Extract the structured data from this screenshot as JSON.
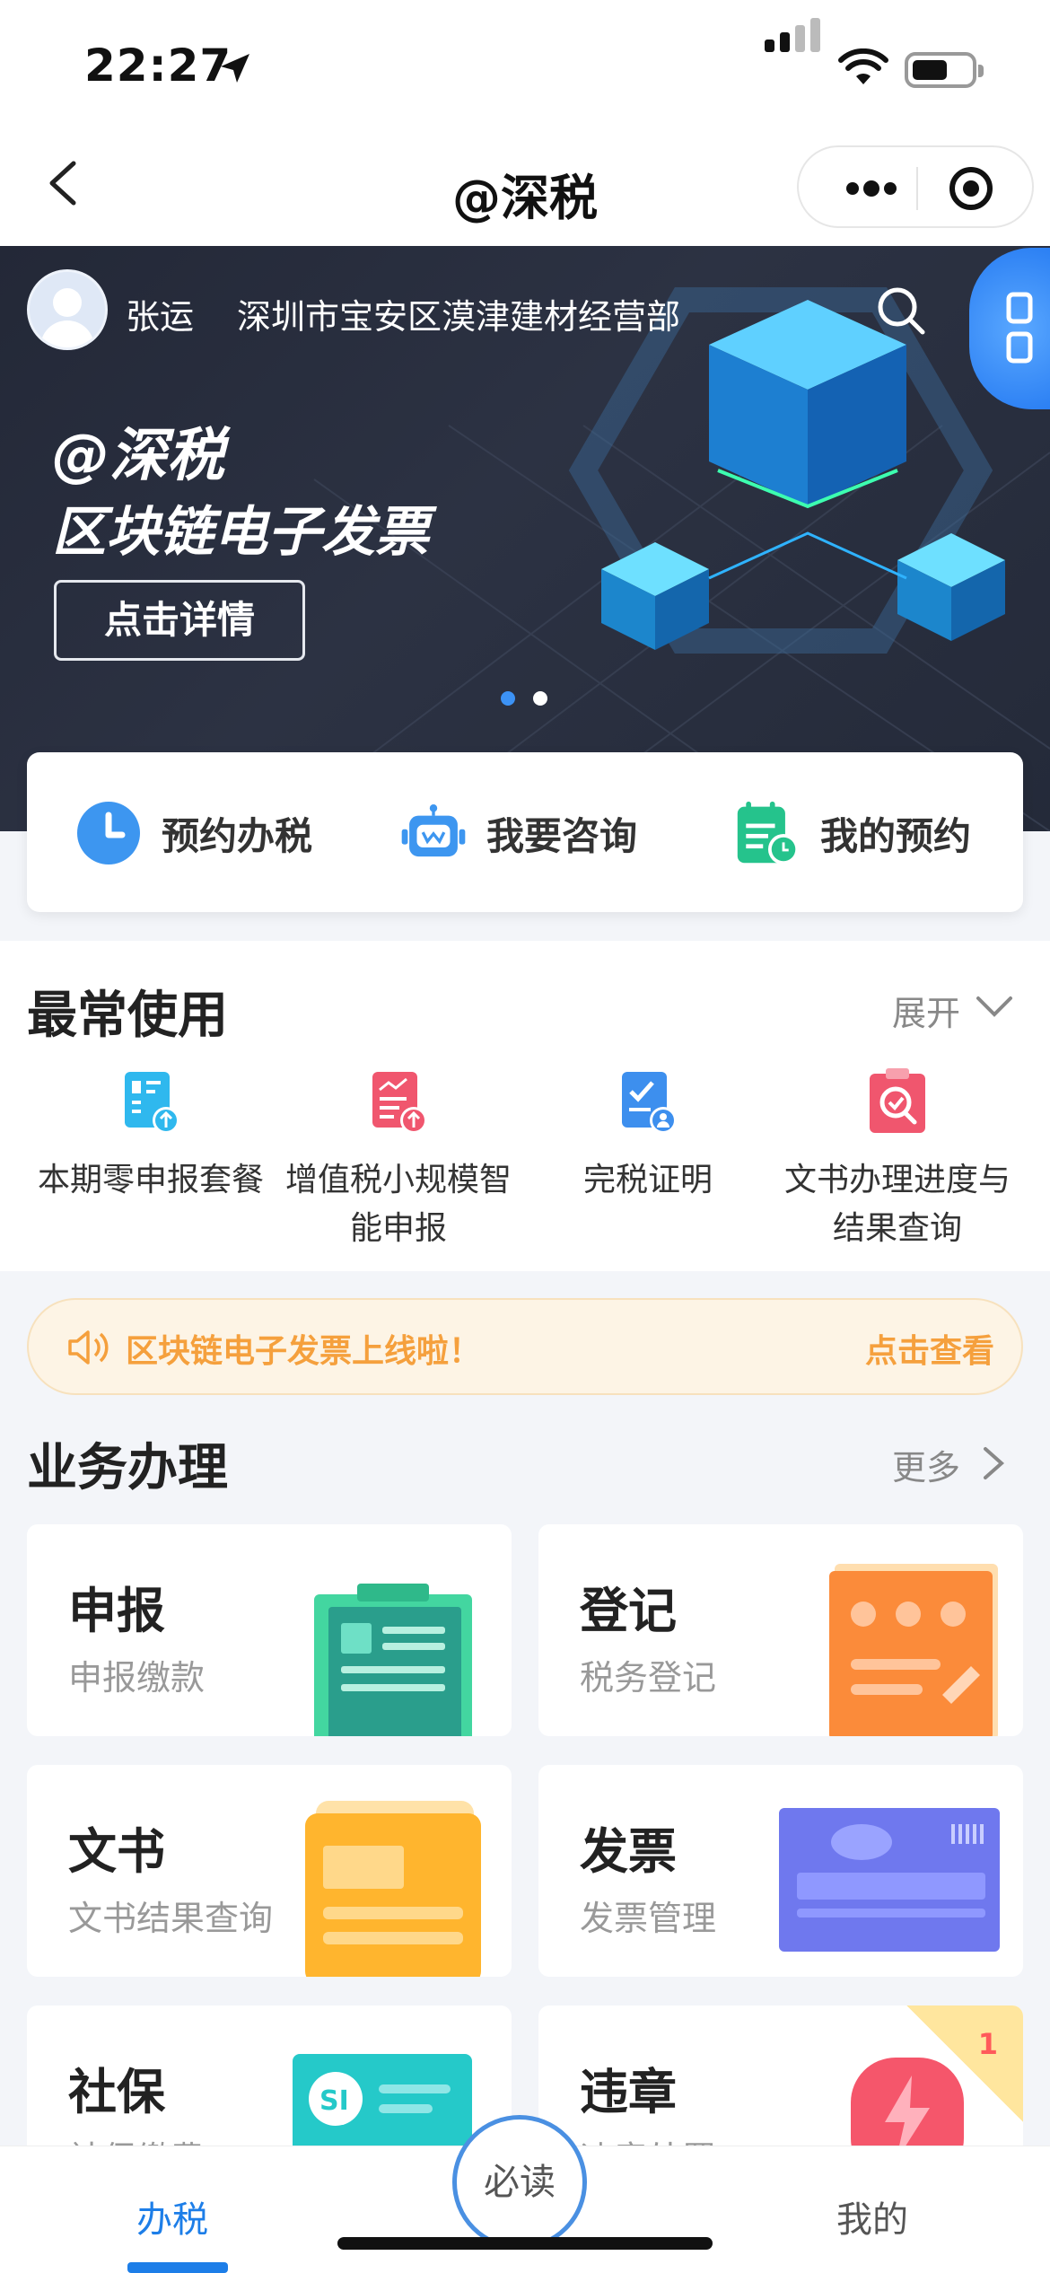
{
  "status_bar": {
    "time": "22:27"
  },
  "nav": {
    "title": "@深税"
  },
  "banner": {
    "user_name": "张运",
    "company": "深圳市宝安区漠津建材经营部",
    "headline_1": "@深税",
    "headline_2": "区块链电子发票",
    "detail_button": "点击详情",
    "slide_count": 2,
    "active_slide": 1
  },
  "quick": {
    "items": [
      {
        "label": "预约办税",
        "icon": "clock-icon"
      },
      {
        "label": "我要咨询",
        "icon": "robot-icon"
      },
      {
        "label": "我的预约",
        "icon": "calendar-icon"
      }
    ]
  },
  "frequent": {
    "title": "最常使用",
    "expand_label": "展开",
    "items": [
      {
        "label": "本期零申报套餐",
        "icon": "zero-declare-icon"
      },
      {
        "label": "增值税小规模智能申报",
        "icon": "vat-declare-icon"
      },
      {
        "label": "完税证明",
        "icon": "tax-certificate-icon"
      },
      {
        "label": "文书办理进度与结果查询",
        "icon": "document-query-icon"
      }
    ]
  },
  "notice": {
    "text": "区块链电子发票上线啦！",
    "link": "点击查看"
  },
  "business": {
    "title": "业务办理",
    "more_label": "更多",
    "cards": [
      {
        "title": "申报",
        "subtitle": "申报缴款"
      },
      {
        "title": "登记",
        "subtitle": "税务登记"
      },
      {
        "title": "文书",
        "subtitle": "文书结果查询"
      },
      {
        "title": "发票",
        "subtitle": "发票管理"
      },
      {
        "title": "社保",
        "subtitle": "社保缴费"
      },
      {
        "title": "违章",
        "subtitle": "违章处罚",
        "badge": "1"
      }
    ]
  },
  "tabbar": {
    "tabs": [
      "办税",
      "必读",
      "我的"
    ],
    "active": "办税"
  },
  "colors": {
    "accent": "#1d7ee8",
    "notice_text": "#f5a03d",
    "notice_bg": "#fdf4e5"
  }
}
